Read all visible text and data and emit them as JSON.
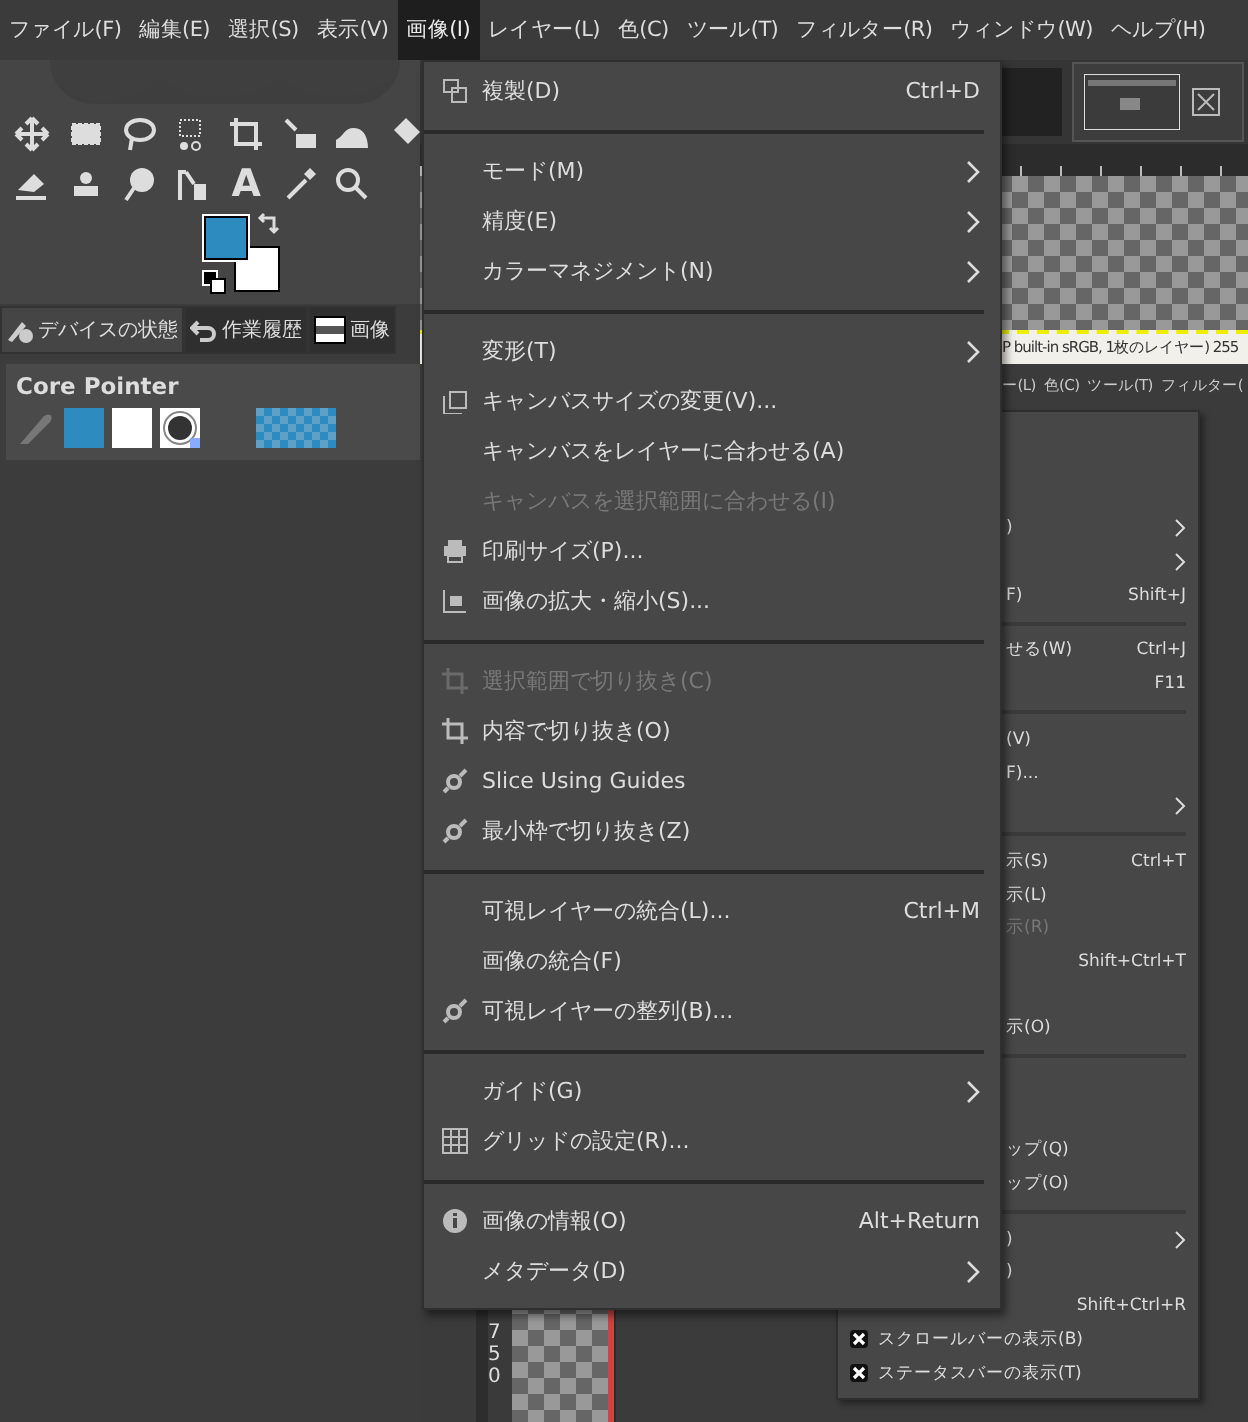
{
  "menubar": [
    {
      "label": "ファイル(F)",
      "selected": false
    },
    {
      "label": "編集(E)",
      "selected": false
    },
    {
      "label": "選択(S)",
      "selected": false
    },
    {
      "label": "表示(V)",
      "selected": false
    },
    {
      "label": "画像(I)",
      "selected": true
    },
    {
      "label": "レイヤー(L)",
      "selected": false
    },
    {
      "label": "色(C)",
      "selected": false
    },
    {
      "label": "ツール(T)",
      "selected": false
    },
    {
      "label": "フィルター(R)",
      "selected": false
    },
    {
      "label": "ウィンドウ(W)",
      "selected": false
    },
    {
      "label": "ヘルプ(H)",
      "selected": false
    }
  ],
  "toolbox": {
    "text_tool_glyph": "A"
  },
  "dock_tabs": [
    {
      "label": "デバイスの状態",
      "selected": true
    },
    {
      "label": "作業履歴",
      "selected": false
    },
    {
      "label": "画像",
      "selected": false
    }
  ],
  "device_status": {
    "name": "Core Pointer"
  },
  "image_window": {
    "status_text": "P built-in sRGB, 1枚のレイヤー) 255",
    "inner_menubar": [
      "ー(L)",
      "色(C)",
      "ツール(T)",
      "フィルター("
    ],
    "inner_menu": [
      {
        "kind": "item"
      },
      {
        "kind": "item"
      },
      {
        "kind": "item"
      },
      {
        "kind": "item",
        "label": ")",
        "submenu": true
      },
      {
        "kind": "item",
        "submenu": true
      },
      {
        "kind": "item",
        "label": "F)",
        "shortcut": "Shift+J"
      },
      {
        "kind": "separator"
      },
      {
        "kind": "item",
        "label": "せる(W)",
        "shortcut": "Ctrl+J"
      },
      {
        "kind": "item",
        "shortcut": "F11"
      },
      {
        "kind": "separator"
      },
      {
        "kind": "item",
        "label": "(V)"
      },
      {
        "kind": "item",
        "label": "F)..."
      },
      {
        "kind": "item",
        "submenu": true
      },
      {
        "kind": "separator"
      },
      {
        "kind": "item",
        "label": "示(S)",
        "shortcut": "Ctrl+T"
      },
      {
        "kind": "item",
        "label": "示(L)"
      },
      {
        "kind": "item",
        "label": "示(R)",
        "disabled": true
      },
      {
        "kind": "item",
        "shortcut": "Shift+Ctrl+T"
      },
      {
        "kind": "item"
      },
      {
        "kind": "item",
        "label": "示(O)"
      },
      {
        "kind": "separator"
      },
      {
        "kind": "item"
      },
      {
        "kind": "item"
      },
      {
        "kind": "item",
        "label": "ップ(Q)"
      },
      {
        "kind": "item",
        "label": "ップ(O)"
      },
      {
        "kind": "separator"
      },
      {
        "kind": "item",
        "label": ")",
        "submenu": true
      },
      {
        "kind": "item",
        "label": ")"
      },
      {
        "kind": "item",
        "shortcut": "Shift+Ctrl+R"
      },
      {
        "kind": "check",
        "label": "スクロールバーの表示(B)",
        "checked": true
      },
      {
        "kind": "check",
        "label": "ステータスバーの表示(T)",
        "checked": true
      }
    ],
    "inner_ruler_digits": "750"
  },
  "image_menu": [
    {
      "kind": "item",
      "label": "複製(D)",
      "shortcut": "Ctrl+D"
    },
    {
      "kind": "separator"
    },
    {
      "kind": "item",
      "label": "モード(M)",
      "submenu": true
    },
    {
      "kind": "item",
      "label": "精度(E)",
      "submenu": true
    },
    {
      "kind": "item",
      "label": "カラーマネジメント(N)",
      "submenu": true
    },
    {
      "kind": "separator"
    },
    {
      "kind": "item",
      "label": "変形(T)",
      "submenu": true
    },
    {
      "kind": "item",
      "label": "キャンバスサイズの変更(V)..."
    },
    {
      "kind": "item",
      "label": "キャンバスをレイヤーに合わせる(A)"
    },
    {
      "kind": "item",
      "label": "キャンバスを選択範囲に合わせる(I)",
      "disabled": true
    },
    {
      "kind": "item",
      "label": "印刷サイズ(P)..."
    },
    {
      "kind": "item",
      "label": "画像の拡大・縮小(S)..."
    },
    {
      "kind": "separator"
    },
    {
      "kind": "item",
      "label": "選択範囲で切り抜き(C)",
      "disabled": true
    },
    {
      "kind": "item",
      "label": "内容で切り抜き(O)"
    },
    {
      "kind": "item",
      "label": "Slice Using Guides"
    },
    {
      "kind": "item",
      "label": "最小枠で切り抜き(Z)"
    },
    {
      "kind": "separator"
    },
    {
      "kind": "item",
      "label": "可視レイヤーの統合(L)...",
      "shortcut": "Ctrl+M"
    },
    {
      "kind": "item",
      "label": "画像の統合(F)"
    },
    {
      "kind": "item",
      "label": "可視レイヤーの整列(B)..."
    },
    {
      "kind": "separator"
    },
    {
      "kind": "item",
      "label": "ガイド(G)",
      "submenu": true
    },
    {
      "kind": "item",
      "label": "グリッドの設定(R)..."
    },
    {
      "kind": "separator"
    },
    {
      "kind": "item",
      "label": "画像の情報(O)",
      "shortcut": "Alt+Return"
    },
    {
      "kind": "item",
      "label": "メタデータ(D)",
      "submenu": true
    }
  ]
}
